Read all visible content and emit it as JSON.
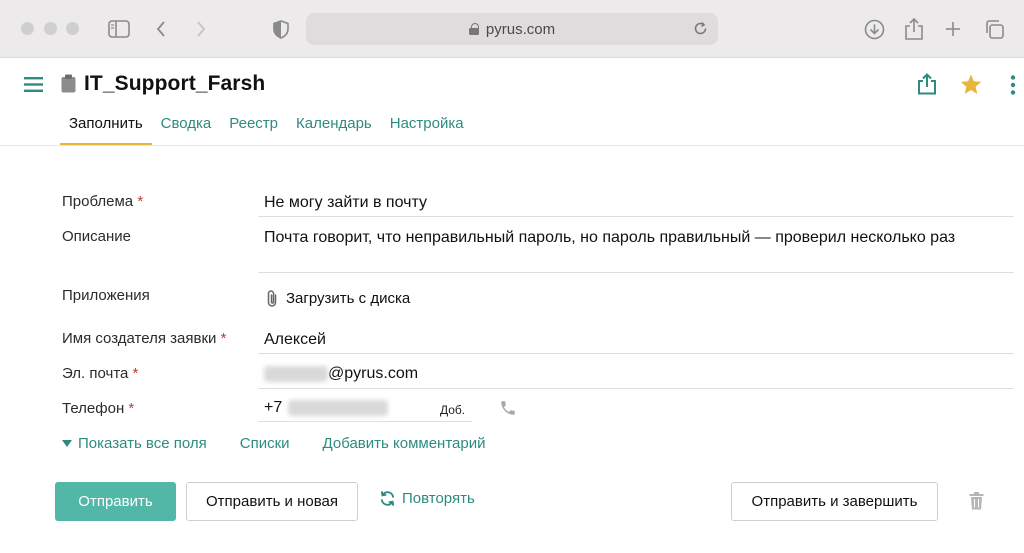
{
  "browser": {
    "url": "pyrus.com"
  },
  "app": {
    "title": "IT_Support_Farsh",
    "accent": "#53b7a8",
    "link_color": "#2e8b82",
    "star_color": "#e8b53c"
  },
  "tabs": [
    {
      "label": "Заполнить",
      "active": true
    },
    {
      "label": "Сводка"
    },
    {
      "label": "Реестр"
    },
    {
      "label": "Календарь"
    },
    {
      "label": "Настройка"
    }
  ],
  "form": {
    "problem": {
      "label": "Проблема",
      "required_mark": "*",
      "value": "Не могу зайти в почту"
    },
    "description": {
      "label": "Описание",
      "value": "Почта говорит, что неправильный пароль, но пароль правильный — проверил несколько раз"
    },
    "attachments": {
      "label": "Приложения",
      "upload_label": "Загрузить с диска"
    },
    "creator_name": {
      "label": "Имя создателя заявки",
      "required_mark": "*",
      "value": "Алексей"
    },
    "email": {
      "label": "Эл. почта",
      "required_mark": "*",
      "value_suffix": "@pyrus.com"
    },
    "phone": {
      "label": "Телефон",
      "required_mark": "*",
      "prefix": "+7",
      "ext_label": "Доб."
    }
  },
  "links": {
    "show_all_fields": "Показать все поля",
    "lists": "Списки",
    "add_comment": "Добавить комментарий"
  },
  "buttons": {
    "submit": "Отправить",
    "submit_and_new": "Отправить и новая",
    "repeat": "Повторять",
    "submit_and_close": "Отправить и завершить"
  }
}
